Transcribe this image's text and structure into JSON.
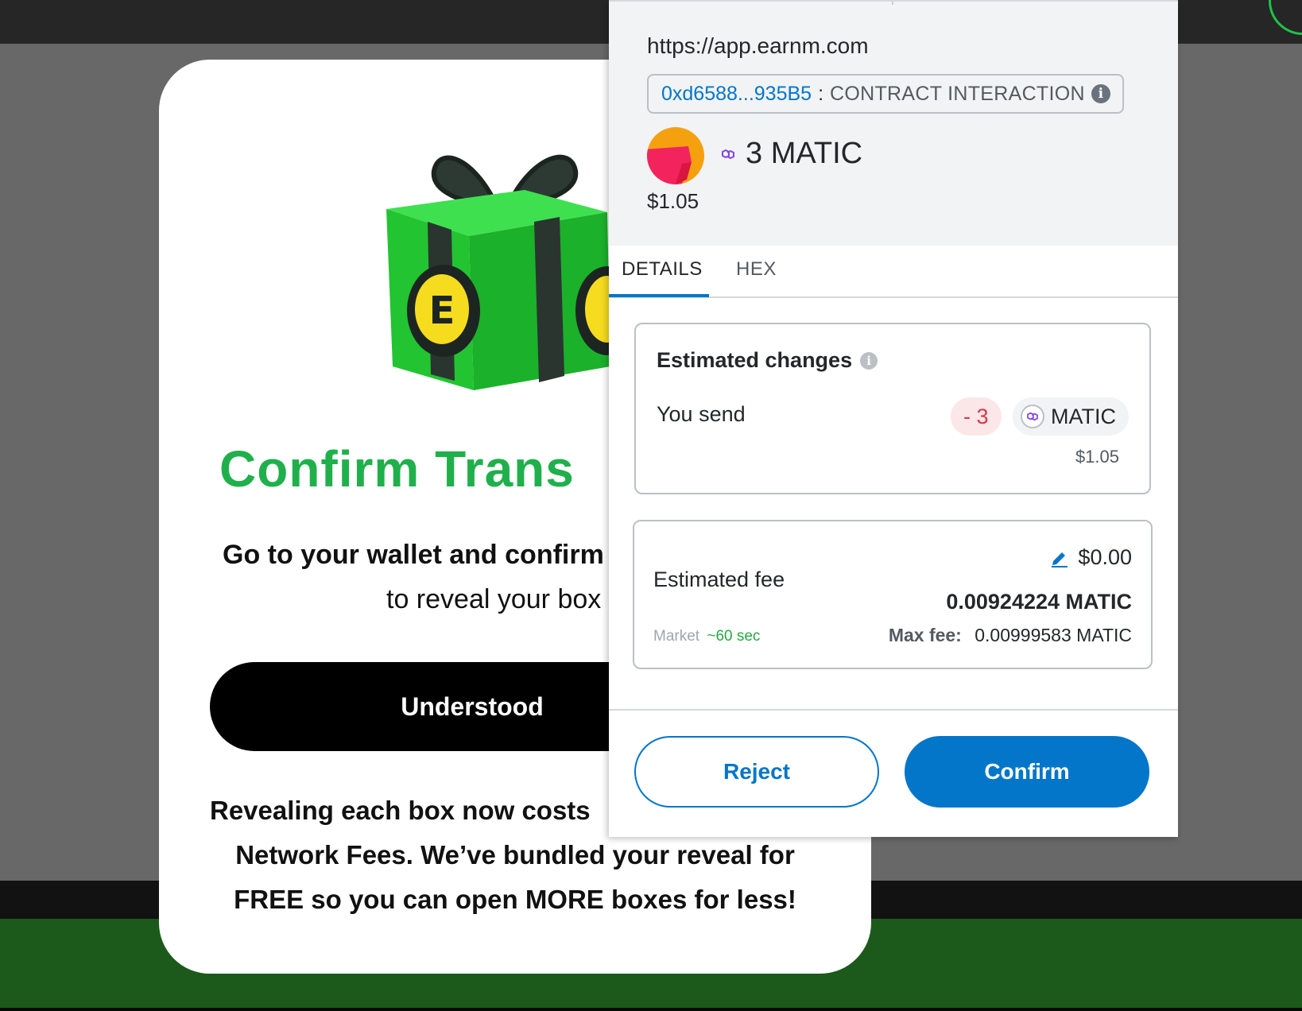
{
  "modal": {
    "title": "Confirm Trans",
    "subtitle_line1": "Go to your wallet and confirm",
    "subtitle_line2": "to reveal your box",
    "understood_label": "Understood",
    "info_line1": "Revealing each box now costs ",
    "info_line2": "Network Fees. We’ve bundled your reveal for",
    "info_line3": "FREE so you can open MORE boxes for less!"
  },
  "wallet": {
    "origin": "https://app.earnm.com",
    "contract_address": "0xd6588...935B5",
    "contract_separator": ":",
    "contract_type": "CONTRACT INTERACTION",
    "amount": "3 MATIC",
    "fiat_amount": "$1.05",
    "tabs": [
      "DETAILS",
      "HEX"
    ],
    "active_tab": "DETAILS",
    "estimated_changes": {
      "title": "Estimated changes",
      "you_send_label": "You send",
      "delta": "- 3",
      "token": "MATIC",
      "fiat": "$1.05"
    },
    "fee": {
      "label": "Estimated fee",
      "usd": "$0.00",
      "native": "0.00924224 MATIC",
      "speed": "Market",
      "time": "~60 sec",
      "max_fee_label": "Max fee:",
      "max_fee_value": "0.00999583 MATIC"
    },
    "buttons": {
      "reject": "Reject",
      "confirm": "Confirm"
    }
  },
  "colors": {
    "accent": "#0376c9",
    "brand_green": "#20b04b",
    "negative": "#d73847"
  },
  "icons": [
    "gift-box-icon",
    "info-icon",
    "polygon-icon",
    "account-avatar-icon",
    "edit-pencil-icon"
  ]
}
